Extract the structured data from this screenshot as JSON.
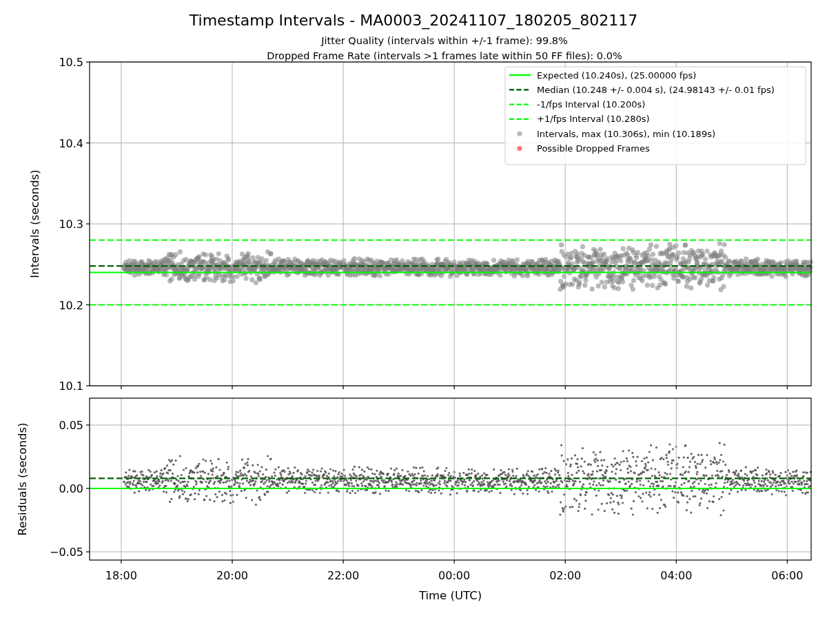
{
  "figure": {
    "title": "Timestamp Intervals - MA0003_20241107_180205_802117",
    "subtitles": [
      "Jitter Quality (intervals within +/-1 frame): 99.8%",
      "Dropped Frame Rate (intervals >1 frames late within 50 FF files): 0.0%"
    ]
  },
  "top_panel": {
    "chart_data": {
      "type": "line",
      "ylabel": "Intervals (seconds)",
      "grid": true,
      "legend": "upper right",
      "x": [
        "2024-11-07T17:25:48",
        "2024-11-08T06:25:48"
      ],
      "xlim": [
        "2024-11-07T17:25:48",
        "2024-11-08T06:25:48"
      ],
      "ylim": [
        10.1,
        10.5
      ],
      "yticks": [
        {
          "value": 10.1,
          "label": "10.1"
        },
        {
          "value": 10.2,
          "label": "10.2"
        },
        {
          "value": 10.3,
          "label": "10.3"
        },
        {
          "value": 10.4,
          "label": "10.4"
        },
        {
          "value": 10.5,
          "label": "10.5"
        }
      ],
      "series": [
        {
          "name": "Expected (10.240s), (25.00000 fps)",
          "color": "#00ff00",
          "line_style": "solid",
          "values": [
            10.24,
            10.24
          ]
        },
        {
          "name": "Median (10.248 +/- 0.004 s), (24.98143 +/- 0.01 fps)",
          "color": "#006400",
          "line_style": "dashed",
          "values": [
            10.248,
            10.248
          ]
        },
        {
          "name": "-1/fps Interval (10.200s)",
          "color": "#00ff00",
          "line_style": "dashed",
          "values": [
            10.2,
            10.2
          ]
        },
        {
          "name": "+1/fps Interval (10.280s)",
          "color": "#00ff00",
          "line_style": "dashed",
          "values": [
            10.28,
            10.28
          ]
        }
      ]
    },
    "marker_legend": [
      {
        "label": "Intervals, max (10.306s), min (10.189s)",
        "color": "#b9b9b9"
      },
      {
        "label": "Possible Dropped Frames",
        "color": "#ff7373"
      }
    ]
  },
  "bottom_panel": {
    "chart_data": {
      "type": "line",
      "xlabel": "Time (UTC)",
      "ylabel": "Residuals (seconds)",
      "grid": true,
      "x": [
        "2024-11-07T17:25:48",
        "2024-11-08T06:25:48"
      ],
      "xlim": [
        "2024-11-07T17:25:48",
        "2024-11-08T06:25:48"
      ],
      "ylim": [
        -0.0565,
        0.0712
      ],
      "xticks": [
        {
          "value": "2024-11-07T18:00",
          "label": "18:00"
        },
        {
          "value": "2024-11-07T20:00",
          "label": "20:00"
        },
        {
          "value": "2024-11-07T22:00",
          "label": "22:00"
        },
        {
          "value": "2024-11-08T00:00",
          "label": "00:00"
        },
        {
          "value": "2024-11-08T02:00",
          "label": "02:00"
        },
        {
          "value": "2024-11-08T04:00",
          "label": "04:00"
        },
        {
          "value": "2024-11-08T06:00",
          "label": "06:00"
        }
      ],
      "yticks": [
        {
          "value": -0.05,
          "label": "−0.05"
        },
        {
          "value": 0,
          "label": "0.00"
        },
        {
          "value": 0.05,
          "label": "0.05"
        }
      ],
      "series": [
        {
          "color": "#00ff00",
          "line_style": "solid",
          "values": [
            0,
            0
          ]
        },
        {
          "color": "#006400",
          "line_style": "dashed",
          "values": [
            0.008,
            0.008
          ]
        }
      ]
    }
  }
}
